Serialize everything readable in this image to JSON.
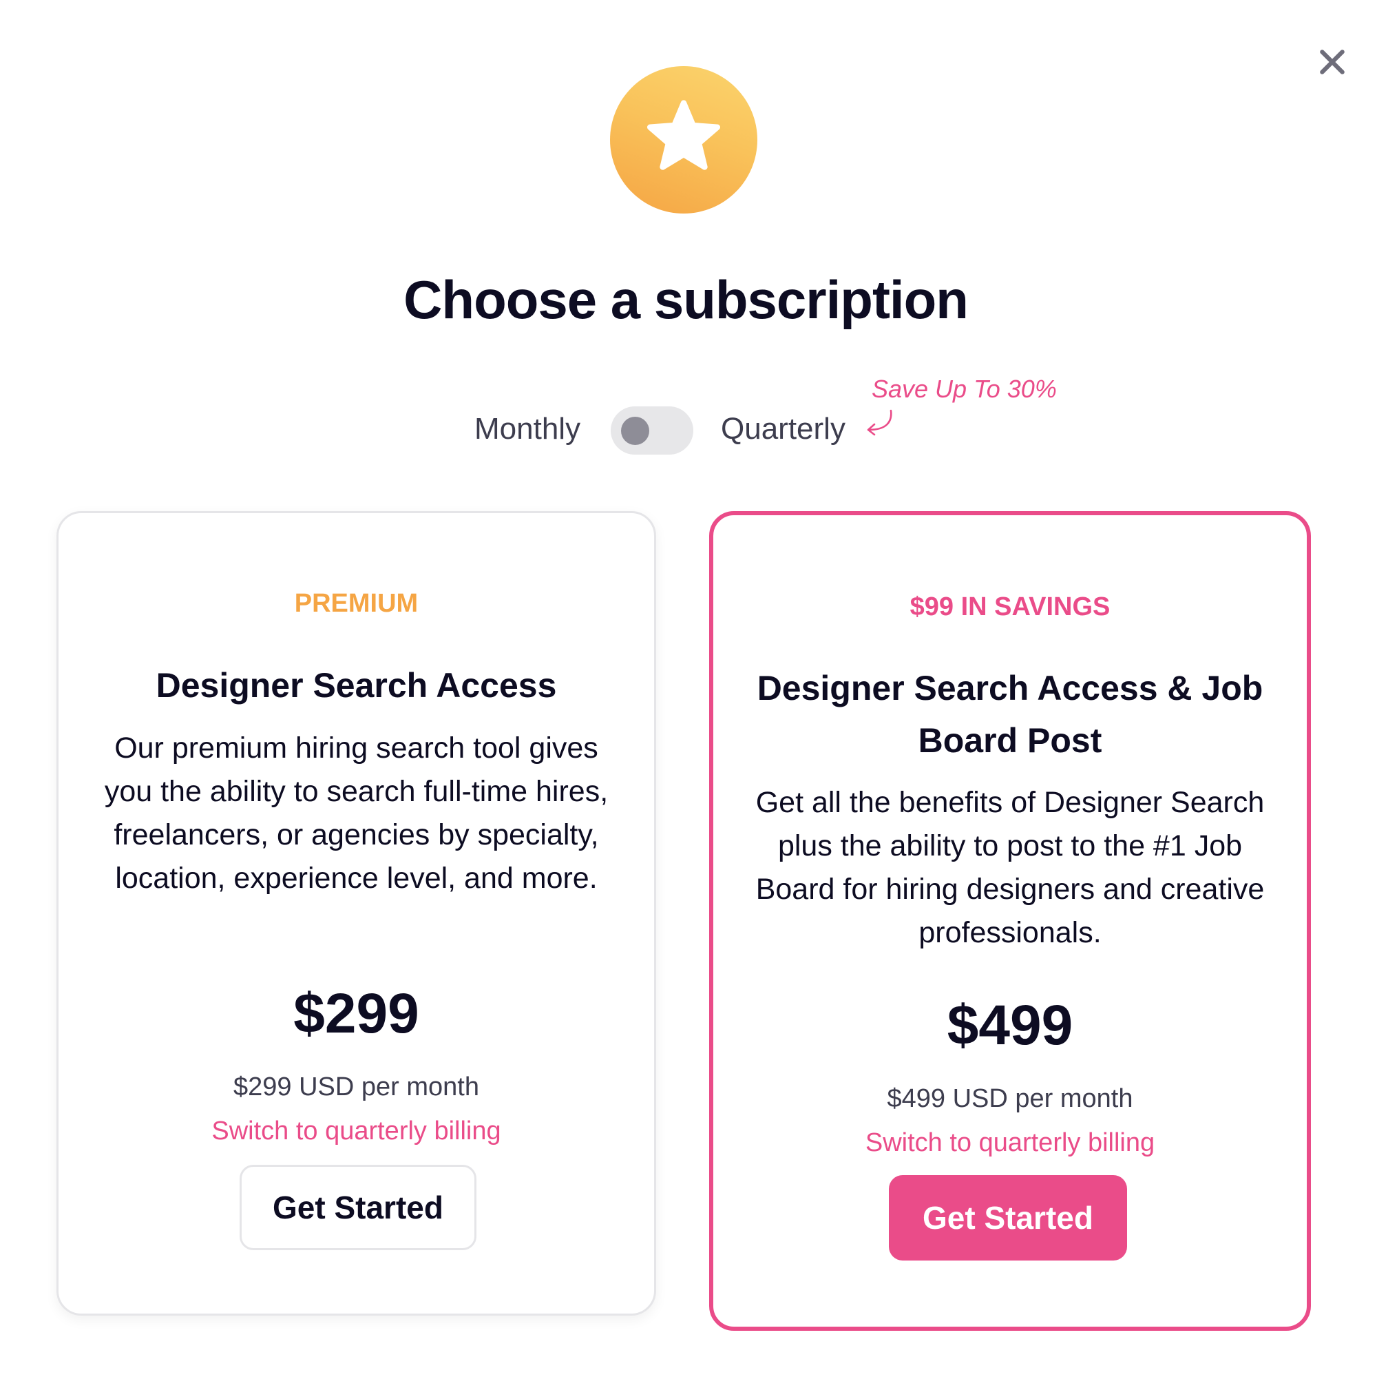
{
  "modal": {
    "close_icon": "close-icon",
    "badge_icon": "star-icon",
    "title": "Choose a subscription"
  },
  "billing": {
    "monthly_label": "Monthly",
    "quarterly_label": "Quarterly",
    "toggle_state": "monthly",
    "save_note": "Save Up To 30%"
  },
  "plans": [
    {
      "tag": "PREMIUM",
      "tag_color": "#f5a544",
      "name": "Designer Search Access",
      "description": "Our premium hiring search tool gives you the ability to search full-time hires, freelancers, or agencies by specialty, location, experience level, and more.",
      "price": "$299",
      "period": "$299 USD per month",
      "switch_link": "Switch to quarterly billing",
      "cta": "Get Started"
    },
    {
      "tag": "$99 IN SAVINGS",
      "tag_color": "#ea4c89",
      "name": "Designer Search Access & Job Board Post",
      "description": "Get all the benefits of Designer Search plus the ability to post to the #1 Job Board for hiring designers and creative professionals.",
      "price": "$499",
      "period": "$499 USD per month",
      "switch_link": "Switch to quarterly billing",
      "cta": "Get Started"
    }
  ],
  "colors": {
    "accent": "#ea4c89",
    "premium": "#f5a544",
    "text": "#0d0c22"
  }
}
